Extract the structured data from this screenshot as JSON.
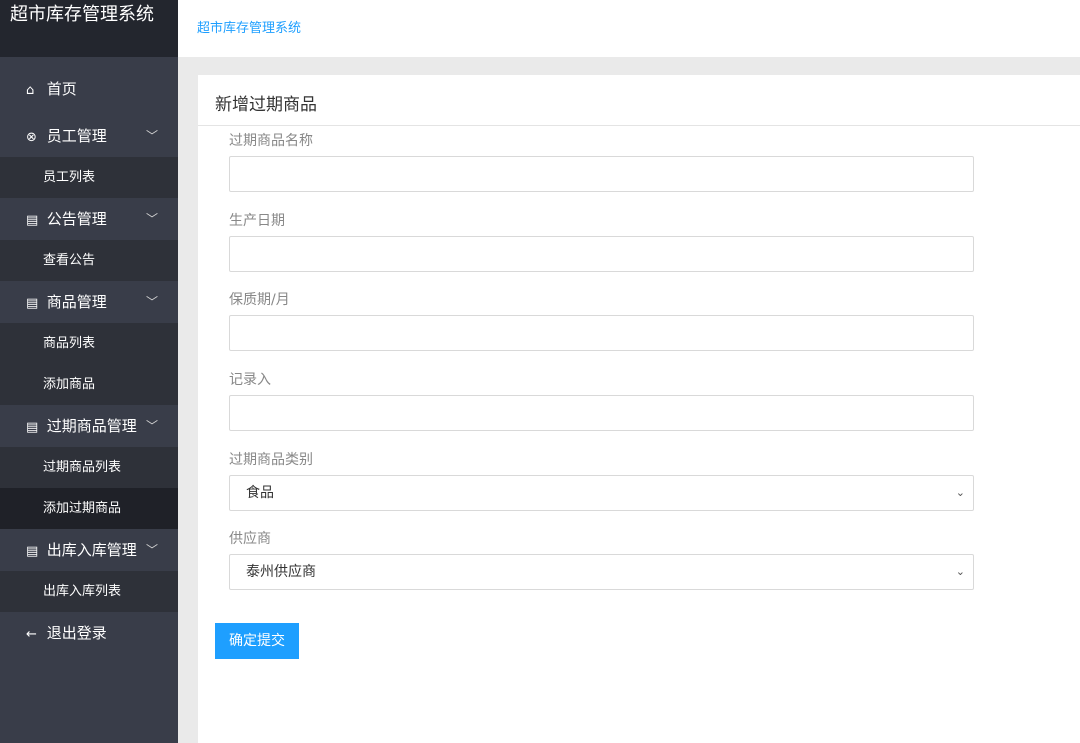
{
  "app": {
    "title": "超市库存管理系统"
  },
  "breadcrumb": "超市库存管理系统",
  "sidebar": {
    "home": {
      "icon": "home-icon",
      "glyph": "⌂",
      "label": "首页"
    },
    "groups": [
      {
        "icon": "user-circle-icon",
        "glyph": "⊗",
        "label": "员工管理",
        "subs": [
          "员工列表"
        ]
      },
      {
        "icon": "document-icon",
        "glyph": "▤",
        "label": "公告管理",
        "subs": [
          "查看公告"
        ]
      },
      {
        "icon": "document-icon",
        "glyph": "▤",
        "label": "商品管理",
        "subs": [
          "商品列表",
          "添加商品"
        ]
      },
      {
        "icon": "document-icon",
        "glyph": "▤",
        "label": "过期商品管理",
        "subs": [
          "过期商品列表",
          "添加过期商品"
        ]
      },
      {
        "icon": "document-icon",
        "glyph": "▤",
        "label": "出库入库管理",
        "subs": [
          "出库入库列表"
        ]
      }
    ],
    "logout": {
      "icon": "arrow-left-icon",
      "glyph": "←",
      "label": "退出登录"
    },
    "active_sub": "添加过期商品"
  },
  "form": {
    "title": "新增过期商品",
    "fields": [
      {
        "label": "过期商品名称",
        "value": ""
      },
      {
        "label": "生产日期",
        "value": ""
      },
      {
        "label": "保质期/月",
        "value": ""
      },
      {
        "label": "记录入",
        "value": ""
      }
    ],
    "category": {
      "label": "过期商品类别",
      "selected": "食品"
    },
    "supplier": {
      "label": "供应商",
      "selected": "泰州供应商"
    },
    "submit_label": "确定提交"
  },
  "colors": {
    "sidebar": "#393d49",
    "accent": "#1e9fff"
  }
}
